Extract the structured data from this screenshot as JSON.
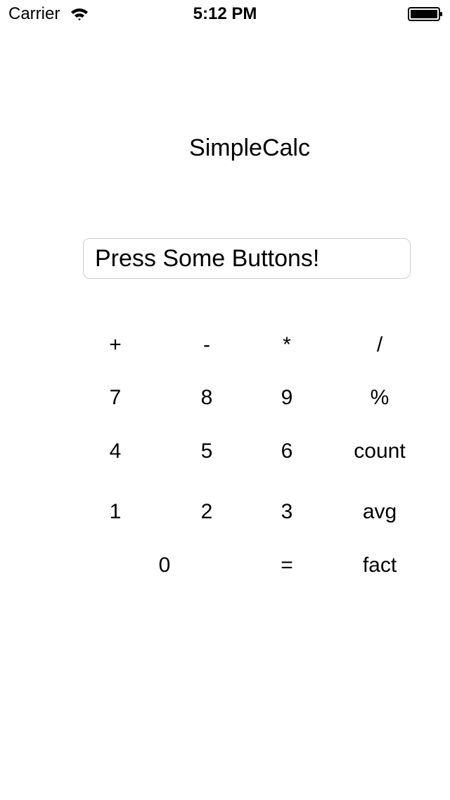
{
  "status_bar": {
    "carrier": "Carrier",
    "time": "5:12 PM",
    "wifi_icon": "wifi-icon",
    "battery_icon": "battery-icon"
  },
  "app": {
    "title": "SimpleCalc"
  },
  "display": {
    "value": "Press Some Buttons!"
  },
  "keypad": {
    "plus": "+",
    "minus": "-",
    "multiply": "*",
    "divide": "/",
    "seven": "7",
    "eight": "8",
    "nine": "9",
    "mod": "%",
    "four": "4",
    "five": "5",
    "six": "6",
    "count": "count",
    "one": "1",
    "two": "2",
    "three": "3",
    "avg": "avg",
    "zero": "0",
    "equals": "=",
    "fact": "fact"
  }
}
